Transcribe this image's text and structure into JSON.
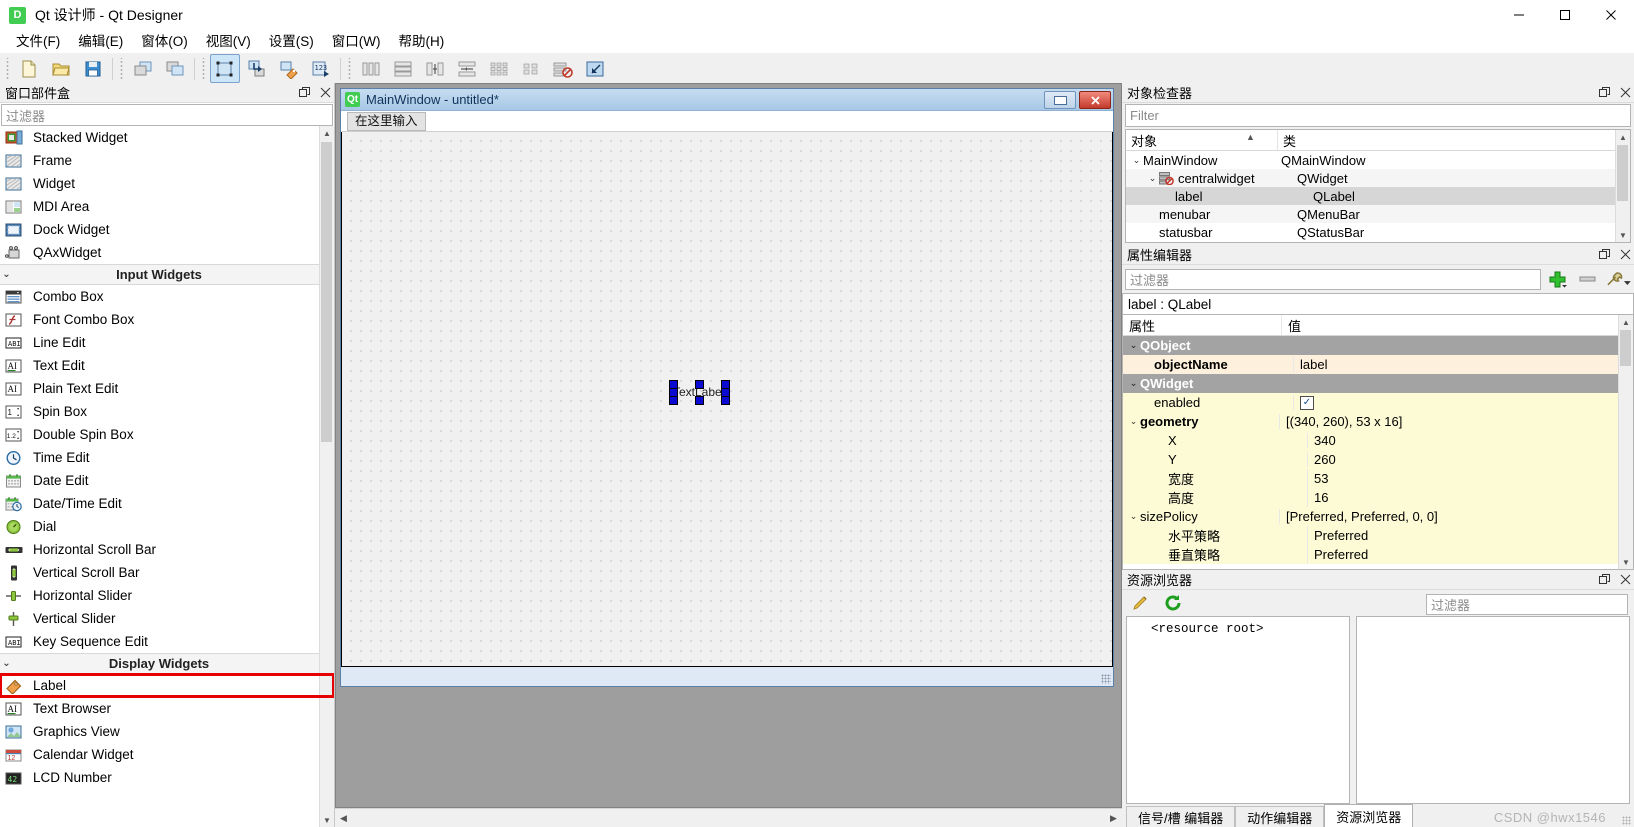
{
  "window": {
    "title": "Qt 设计师 - Qt Designer",
    "app_icon": "D",
    "minimize": "minimize-icon",
    "maximize": "maximize-icon",
    "close": "close-icon"
  },
  "menubar": {
    "items": [
      {
        "label": "文件(F)",
        "name": "menu-file"
      },
      {
        "label": "编辑(E)",
        "name": "menu-edit"
      },
      {
        "label": "窗体(O)",
        "name": "menu-form"
      },
      {
        "label": "视图(V)",
        "name": "menu-view"
      },
      {
        "label": "设置(S)",
        "name": "menu-settings"
      },
      {
        "label": "窗口(W)",
        "name": "menu-window"
      },
      {
        "label": "帮助(H)",
        "name": "menu-help"
      }
    ]
  },
  "toolbar": {
    "groups": [
      [
        "new-file-icon",
        "open-file-icon",
        "save-file-icon"
      ],
      [
        "undo-icon",
        "redo-icon"
      ],
      [
        "edit-widgets-icon",
        "edit-signals-slots-icon",
        "edit-buddies-icon",
        "edit-tab-order-icon"
      ],
      [
        "layout-horizontally-icon",
        "layout-vertically-icon",
        "layout-splitter-horizontal-icon",
        "layout-splitter-vertical-icon",
        "layout-grid-icon",
        "layout-form-icon",
        "break-layout-icon",
        "adjust-size-icon"
      ]
    ]
  },
  "widgetbox": {
    "title": "窗口部件盒",
    "filter_placeholder": "过滤器",
    "rows": [
      {
        "kind": "item",
        "label": "Stacked Widget",
        "icon": "stacked-widget-icon"
      },
      {
        "kind": "item",
        "label": "Frame",
        "icon": "frame-icon"
      },
      {
        "kind": "item",
        "label": "Widget",
        "icon": "widget-icon"
      },
      {
        "kind": "item",
        "label": "MDI Area",
        "icon": "mdi-area-icon"
      },
      {
        "kind": "item",
        "label": "Dock Widget",
        "icon": "dock-widget-icon"
      },
      {
        "kind": "item",
        "label": "QAxWidget",
        "icon": "qax-widget-icon"
      },
      {
        "kind": "group",
        "label": "Input Widgets"
      },
      {
        "kind": "item",
        "label": "Combo Box",
        "icon": "combo-box-icon"
      },
      {
        "kind": "item",
        "label": "Font Combo Box",
        "icon": "font-combo-box-icon"
      },
      {
        "kind": "item",
        "label": "Line Edit",
        "icon": "line-edit-icon"
      },
      {
        "kind": "item",
        "label": "Text Edit",
        "icon": "text-edit-icon"
      },
      {
        "kind": "item",
        "label": "Plain Text Edit",
        "icon": "plain-text-edit-icon"
      },
      {
        "kind": "item",
        "label": "Spin Box",
        "icon": "spin-box-icon"
      },
      {
        "kind": "item",
        "label": "Double Spin Box",
        "icon": "double-spin-box-icon"
      },
      {
        "kind": "item",
        "label": "Time Edit",
        "icon": "time-edit-icon"
      },
      {
        "kind": "item",
        "label": "Date Edit",
        "icon": "date-edit-icon"
      },
      {
        "kind": "item",
        "label": "Date/Time Edit",
        "icon": "date-time-edit-icon"
      },
      {
        "kind": "item",
        "label": "Dial",
        "icon": "dial-icon"
      },
      {
        "kind": "item",
        "label": "Horizontal Scroll Bar",
        "icon": "horizontal-scroll-bar-icon"
      },
      {
        "kind": "item",
        "label": "Vertical Scroll Bar",
        "icon": "vertical-scroll-bar-icon"
      },
      {
        "kind": "item",
        "label": "Horizontal Slider",
        "icon": "horizontal-slider-icon"
      },
      {
        "kind": "item",
        "label": "Vertical Slider",
        "icon": "vertical-slider-icon"
      },
      {
        "kind": "item",
        "label": "Key Sequence Edit",
        "icon": "key-sequence-edit-icon"
      },
      {
        "kind": "group",
        "label": "Display Widgets"
      },
      {
        "kind": "item",
        "label": "Label",
        "icon": "label-icon",
        "highlighted": true
      },
      {
        "kind": "item",
        "label": "Text Browser",
        "icon": "text-browser-icon"
      },
      {
        "kind": "item",
        "label": "Graphics View",
        "icon": "graphics-view-icon"
      },
      {
        "kind": "item",
        "label": "Calendar Widget",
        "icon": "calendar-widget-icon"
      },
      {
        "kind": "item",
        "label": "LCD Number",
        "icon": "lcd-number-icon"
      }
    ],
    "highlight_color": "#e60000"
  },
  "form": {
    "title": "MainWindow - untitled*",
    "icon": "qt-logo-icon",
    "minimize": "minimize-icon",
    "close": "close-icon",
    "menu_placeholder": "在这里输入",
    "selected_widget_text": "TextLabel"
  },
  "object_inspector": {
    "title": "对象检查器",
    "filter_placeholder": "Filter",
    "columns": [
      "对象",
      "类"
    ],
    "rows": [
      {
        "indent": 0,
        "expander": "expanded",
        "name": "MainWindow",
        "class": "QMainWindow",
        "icon": null,
        "selected": false
      },
      {
        "indent": 1,
        "expander": "expanded",
        "name": "centralwidget",
        "class": "QWidget",
        "icon": "no-layout-icon",
        "selected": false
      },
      {
        "indent": 2,
        "expander": "none",
        "name": "label",
        "class": "QLabel",
        "icon": null,
        "selected": true
      },
      {
        "indent": 1,
        "expander": "none",
        "name": "menubar",
        "class": "QMenuBar",
        "icon": null,
        "selected": false
      },
      {
        "indent": 1,
        "expander": "none",
        "name": "statusbar",
        "class": "QStatusBar",
        "icon": null,
        "selected": false
      }
    ]
  },
  "property_editor": {
    "title": "属性编辑器",
    "filter_placeholder": "过滤器",
    "add_button": "add-icon",
    "remove_button": "remove-icon",
    "configure_button": "wrench-icon",
    "object_line": "label : QLabel",
    "columns": [
      "属性",
      "值"
    ],
    "rows": [
      {
        "style": "group",
        "indent": 0,
        "expander": "expanded",
        "name": "QObject",
        "value": ""
      },
      {
        "style": "hl1",
        "indent": 1,
        "expander": "none",
        "name": "objectName",
        "value": "label",
        "bold": true
      },
      {
        "style": "group",
        "indent": 0,
        "expander": "expanded",
        "name": "QWidget",
        "value": ""
      },
      {
        "style": "hl2",
        "indent": 1,
        "expander": "none",
        "name": "enabled",
        "value": "",
        "checkbox": true
      },
      {
        "style": "hl2",
        "indent": 0,
        "expander": "expanded",
        "name": "geometry",
        "value": "[(340, 260), 53 x 16]",
        "bold": true
      },
      {
        "style": "hl2",
        "indent": 2,
        "expander": "none",
        "name": "X",
        "value": "340"
      },
      {
        "style": "hl2",
        "indent": 2,
        "expander": "none",
        "name": "Y",
        "value": "260"
      },
      {
        "style": "hl2",
        "indent": 2,
        "expander": "none",
        "name": "宽度",
        "value": "53"
      },
      {
        "style": "hl2",
        "indent": 2,
        "expander": "none",
        "name": "高度",
        "value": "16"
      },
      {
        "style": "hl2",
        "indent": 0,
        "expander": "expanded",
        "name": "sizePolicy",
        "value": "[Preferred, Preferred, 0, 0]"
      },
      {
        "style": "hl2",
        "indent": 2,
        "expander": "none",
        "name": "水平策略",
        "value": "Preferred"
      },
      {
        "style": "hl2",
        "indent": 2,
        "expander": "none",
        "name": "垂直策略",
        "value": "Preferred"
      }
    ]
  },
  "resource_browser": {
    "title": "资源浏览器",
    "edit_button": "pencil-icon",
    "reload_button": "reload-icon",
    "filter_placeholder": "过滤器",
    "tree_root": "<resource root>"
  },
  "bottom_tabs": {
    "items": [
      {
        "label": "信号/槽 编辑器",
        "active": false
      },
      {
        "label": "动作编辑器",
        "active": false
      },
      {
        "label": "资源浏览器",
        "active": true
      }
    ]
  },
  "watermark": "CSDN @hwx1546"
}
